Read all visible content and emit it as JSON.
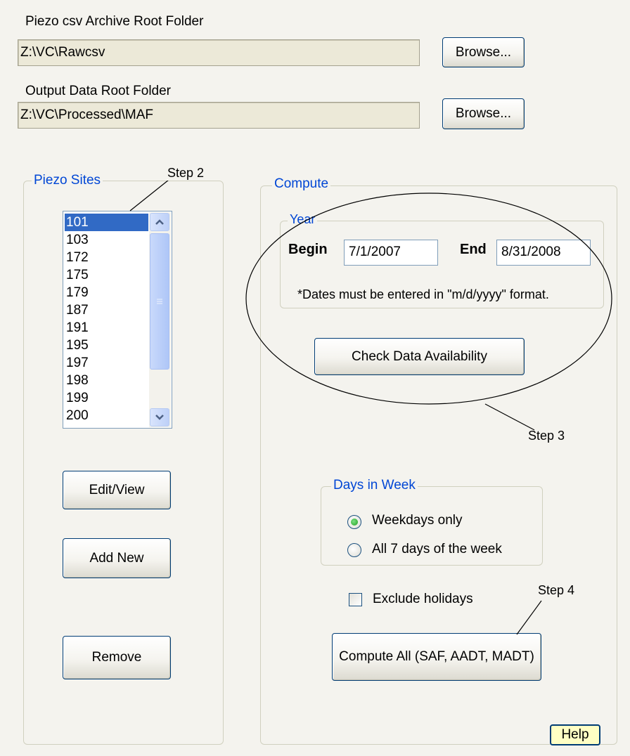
{
  "archive": {
    "label": "Piezo csv Archive Root Folder",
    "path": "Z:\\VC\\Rawcsv",
    "browse_label": "Browse..."
  },
  "output": {
    "label": "Output Data Root Folder",
    "path": "Z:\\VC\\Processed\\MAF",
    "browse_label": "Browse..."
  },
  "piezo_sites": {
    "title": "Piezo Sites",
    "items": [
      "101",
      "103",
      "172",
      "175",
      "179",
      "187",
      "191",
      "195",
      "197",
      "198",
      "199",
      "200"
    ],
    "selected": "101",
    "edit_label": "Edit/View",
    "add_label": "Add New",
    "remove_label": "Remove"
  },
  "compute": {
    "title": "Compute",
    "year": {
      "title": "Year",
      "begin_label": "Begin",
      "begin_value": "7/1/2007",
      "end_label": "End",
      "end_value": "8/31/2008",
      "note": "*Dates must be entered in \"m/d/yyyy\" format."
    },
    "check_label": "Check Data Availability",
    "days": {
      "title": "Days in Week",
      "option_weekdays": "Weekdays only",
      "option_all": "All 7 days of the week",
      "selected": "Weekdays only"
    },
    "exclude_holidays_label": "Exclude holidays",
    "exclude_holidays_checked": false,
    "compute_all_label": "Compute All (SAF, AADT, MADT)",
    "help_label": "Help"
  },
  "annotations": {
    "step2": "Step 2",
    "step3": "Step 3",
    "step4": "Step 4"
  },
  "colors": {
    "window_bg": "#f4f3ee",
    "group_title": "#0046d5",
    "selection": "#316ac5",
    "field_bg": "#ece9d8",
    "help_bg": "#ffffc4"
  }
}
